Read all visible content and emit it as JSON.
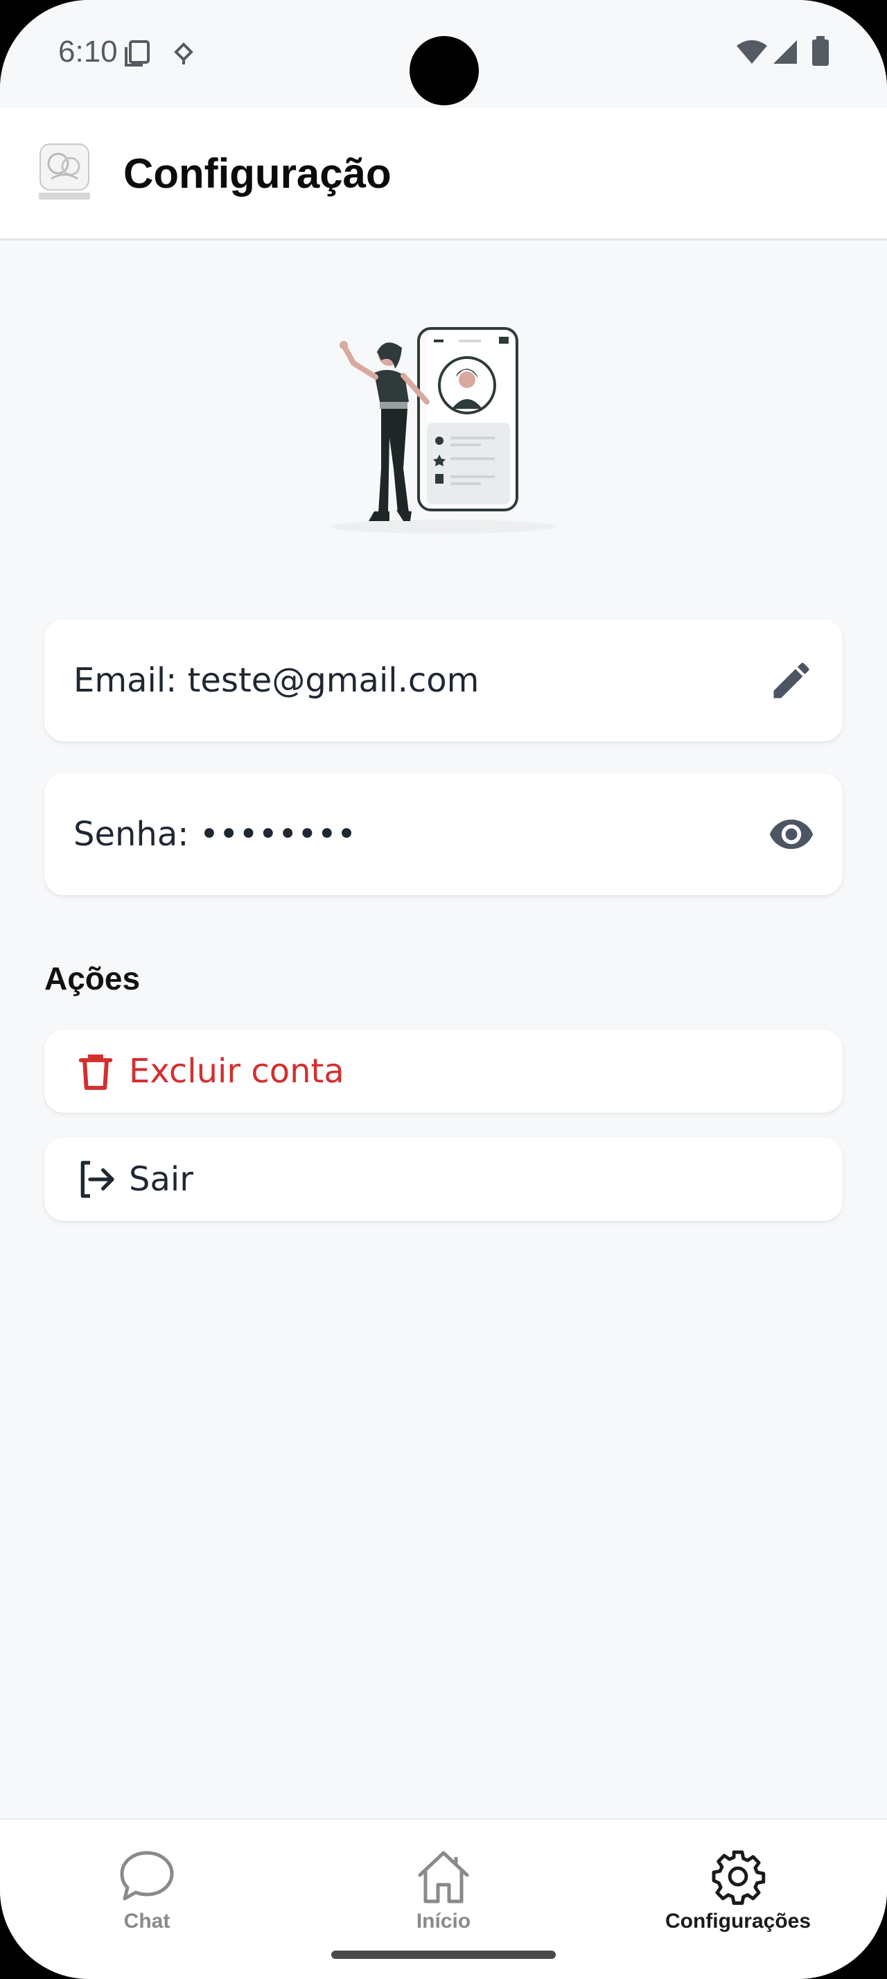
{
  "status_bar": {
    "time": "6:10"
  },
  "app_bar": {
    "title": "Configuração"
  },
  "fields": {
    "email": {
      "label": "Email:",
      "value": "teste@gmail.com"
    },
    "password": {
      "label": "Senha:",
      "value": "••••••••"
    }
  },
  "actions": {
    "section_title": "Ações",
    "delete_account": "Excluir conta",
    "logout": "Sair"
  },
  "bottom_nav": {
    "items": [
      {
        "label": "Chat",
        "icon": "chat-bubble-icon",
        "active": false
      },
      {
        "label": "Início",
        "icon": "home-icon",
        "active": false
      },
      {
        "label": "Configurações",
        "icon": "gear-icon",
        "active": true
      }
    ]
  },
  "colors": {
    "danger": "#d32f2f",
    "text": "#1f2733",
    "nav_inactive": "#8a8a8a",
    "nav_active": "#1a1a1a",
    "background": "#f7f8fa"
  }
}
